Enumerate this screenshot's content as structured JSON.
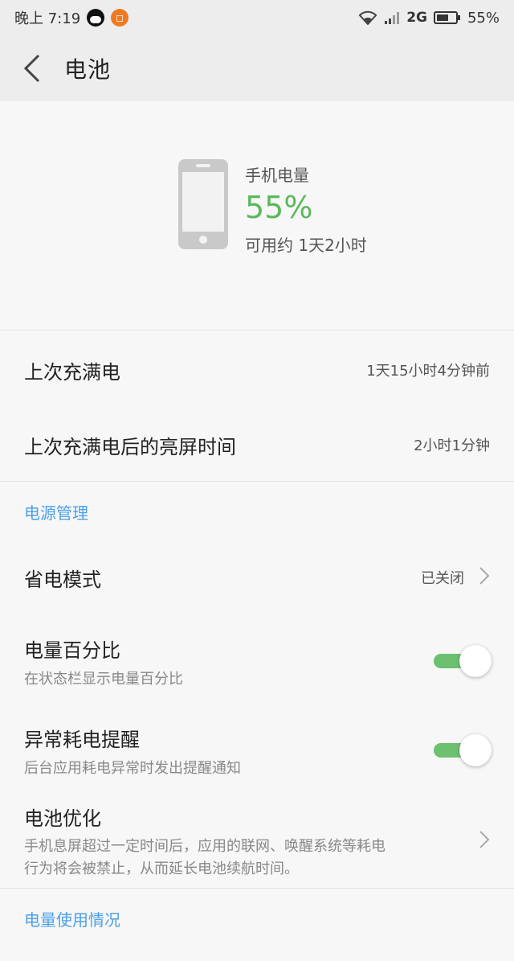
{
  "status_bar": {
    "time": "晚上 7:19",
    "network": "2G",
    "battery_percent": "55%"
  },
  "header": {
    "title": "电池"
  },
  "hero": {
    "label": "手机电量",
    "percent": "55%",
    "remaining": "可用约 1天2小时"
  },
  "stats": [
    {
      "title": "上次充满电",
      "value": "1天15小时4分钟前"
    },
    {
      "title": "上次充满电后的亮屏时间",
      "value": "2小时1分钟"
    }
  ],
  "power_management": {
    "header": "电源管理",
    "save_mode": {
      "title": "省电模式",
      "value": "已关闭"
    },
    "percentage": {
      "title": "电量百分比",
      "subtitle": "在状态栏显示电量百分比",
      "enabled": true
    },
    "abnormal_alert": {
      "title": "异常耗电提醒",
      "subtitle": "后台应用耗电异常时发出提醒通知",
      "enabled": true
    },
    "optimization": {
      "title": "电池优化",
      "subtitle_line1": "手机息屏超过一定时间后，应用的联网、唤醒系统等耗电",
      "subtitle_line2": "行为将会被禁止，从而延长电池续航时间。"
    }
  },
  "usage": {
    "header": "电量使用情况"
  },
  "colors": {
    "accent_blue": "#4a9fe8",
    "battery_green": "#5cb85c",
    "toggle_green": "#6cc070"
  }
}
